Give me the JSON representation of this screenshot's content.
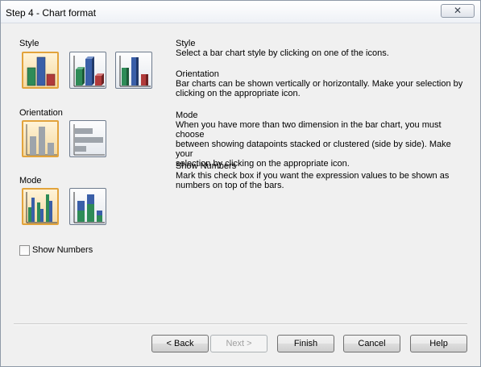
{
  "window": {
    "title": "Step 4 - Chart format",
    "close_glyph": "✕"
  },
  "left": {
    "style_label": "Style",
    "orientation_label": "Orientation",
    "mode_label": "Mode",
    "show_numbers_label": "Show Numbers",
    "show_numbers_checked": false,
    "selected_style": 1,
    "selected_orientation": 1,
    "selected_mode": 1
  },
  "descriptions": {
    "style_title": "Style",
    "style_text": "Select a bar chart style by clicking on one of the icons.",
    "orientation_title": "Orientation",
    "orientation_text_1": "Bar charts can be shown vertically or horizontally. Make your selection by",
    "orientation_text_2": "clicking on the appropriate icon.",
    "mode_title": "Mode",
    "mode_text_1": "When you have more than two dimension in the bar chart, you must choose",
    "mode_text_2": "between showing datapoints stacked or clustered (side by side). Make your",
    "mode_text_3": "selection by clicking on the appropriate icon.",
    "shownumbers_title": "Show Numbers",
    "shownumbers_text_1": "Mark this check box if you want the expression values to be shown as",
    "shownumbers_text_2": "numbers on top of the bars."
  },
  "buttons": {
    "back": "< Back",
    "next": "Next >",
    "finish": "Finish",
    "cancel": "Cancel",
    "help": "Help"
  },
  "colors": {
    "bar_green": "#2e8b57",
    "bar_blue": "#3a5fa8",
    "bar_red": "#b03a3a",
    "bar_gray": "#9ea4ab",
    "selected_border": "#e2a33c"
  }
}
